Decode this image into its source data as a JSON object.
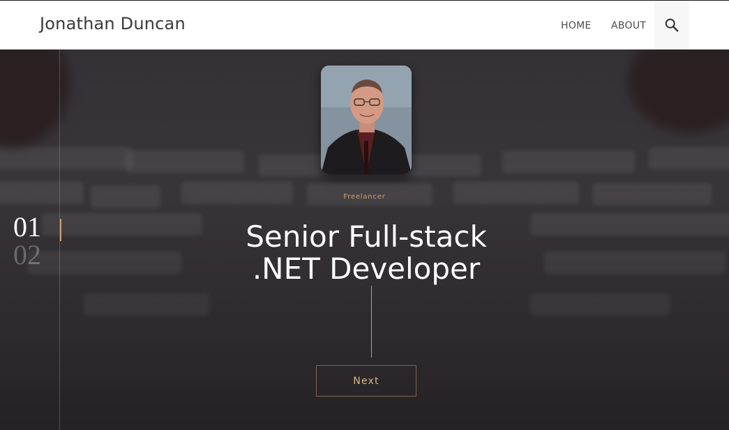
{
  "header": {
    "brand": "Jonathan Duncan",
    "nav": [
      {
        "label": "HOME"
      },
      {
        "label": "ABOUT"
      }
    ],
    "search_icon": "search-icon"
  },
  "hero": {
    "role": "Freelancer",
    "headline_line1": "Senior Full-stack",
    "headline_line2": ".NET Developer",
    "button_label": "Next",
    "slides": [
      {
        "number": "01",
        "active": true
      },
      {
        "number": "02",
        "active": false
      }
    ]
  },
  "colors": {
    "accent": "#c9a06e",
    "header_bg": "#ffffff",
    "hero_bg": "#3a373a"
  }
}
